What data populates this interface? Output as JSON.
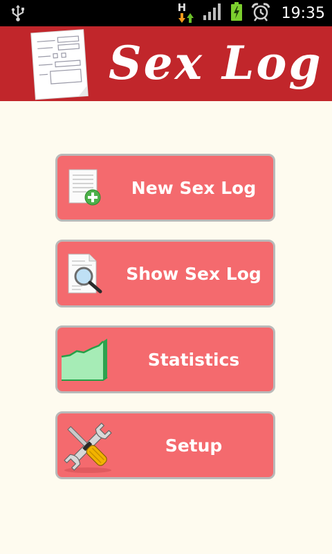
{
  "status_bar": {
    "time": "19:35",
    "network_type": "H",
    "icons": [
      "usb-icon",
      "data-activity-icon",
      "signal-icon",
      "battery-charging-icon",
      "alarm-icon"
    ]
  },
  "header": {
    "title": "Sex Log",
    "logo_icon": "form-document-icon",
    "background_color": "#c1262b"
  },
  "menu": [
    {
      "label": "New Sex Log",
      "icon": "new-document-icon"
    },
    {
      "label": "Show Sex Log",
      "icon": "document-search-icon"
    },
    {
      "label": "Statistics",
      "icon": "chart-icon"
    },
    {
      "label": "Setup",
      "icon": "tools-icon"
    }
  ],
  "colors": {
    "button_fill": "#f46a6e",
    "button_border": "#b9b9b9",
    "page_background": "#fefbef"
  }
}
